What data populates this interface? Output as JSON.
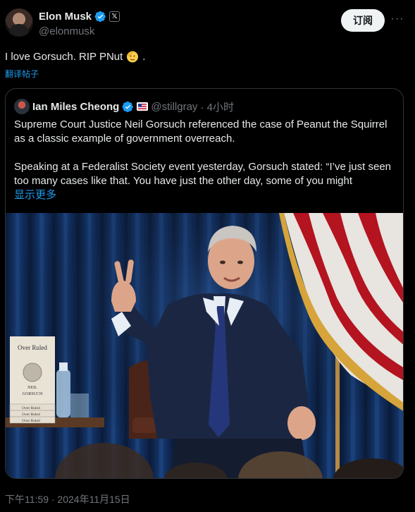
{
  "author": {
    "name": "Elon Musk",
    "handle": "@elonmusk",
    "badge": "𝕏"
  },
  "actions": {
    "subscribe_label": "订阅",
    "more_label": "···"
  },
  "post": {
    "text": "I love Gorsuch. RIP PNut",
    "text_suffix": ".",
    "translate_label": "翻译帖子",
    "timestamp": "下午11:59 · 2024年11月15日"
  },
  "quote": {
    "name": "Ian Miles Cheong",
    "handle": "@stillgray",
    "time": "· 4小时",
    "paragraph1": "Supreme Court Justice Neil Gorsuch referenced the case of Peanut the Squirrel as a classic example of government overreach.",
    "paragraph2": "Speaking at a Federalist Society event yesterday, Gorsuch stated: “I’ve just seen too many cases like that. You have just the other day, some of you might",
    "show_more": "显示更多"
  },
  "photo": {
    "book_title": "Over Ruled",
    "book_author_1": "NEIL",
    "book_author_2": "GORSUCH",
    "spine_1": "Over Ruled",
    "spine_2": "Over Ruled",
    "spine_3": "Over Ruled"
  },
  "colors": {
    "link": "#1d9bf0",
    "verified": "#1d9bf0",
    "muted": "#71767b"
  }
}
